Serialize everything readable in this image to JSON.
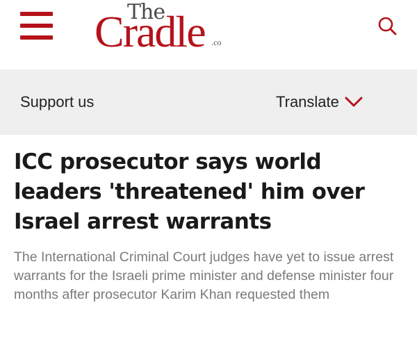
{
  "header": {
    "menu_icon": "hamburger-menu-icon",
    "logo": {
      "the": "The",
      "cradle": "Cradle",
      "co": ".co"
    },
    "search_icon": "search-icon",
    "brand_color": "#b5121b"
  },
  "support_bar": {
    "support_label": "Support us",
    "translate_label": "Translate",
    "translate_icon": "chevron-down-icon",
    "background": "#efefef"
  },
  "article": {
    "title": "ICC prosecutor says world leaders 'threatened' him over Israel arrest warrants",
    "summary": "The International Criminal Court judges have yet to issue arrest warrants for the Israeli prime minister and defense minister four months after prosecutor Karim Khan requested them"
  }
}
